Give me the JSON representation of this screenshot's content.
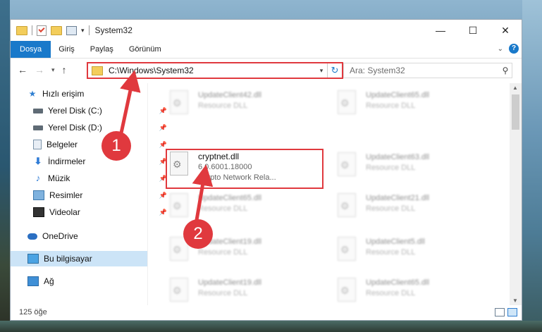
{
  "window": {
    "title": "System32",
    "controls": [
      "minimize-icon",
      "maximize-icon",
      "close-icon"
    ]
  },
  "ribbon": {
    "tabs": [
      {
        "label": "Dosya",
        "active": true
      },
      {
        "label": "Giriş"
      },
      {
        "label": "Paylaş"
      },
      {
        "label": "Görünüm"
      }
    ]
  },
  "address": {
    "path": "C:\\Windows\\System32",
    "search_placeholder": "Ara: System32"
  },
  "sidebar": {
    "quick_access": "Hızlı erişim",
    "items": [
      {
        "label": "Yerel Disk (C:)",
        "icon": "disk-icon",
        "pinned": true
      },
      {
        "label": "Yerel Disk (D:)",
        "icon": "disk-icon",
        "pinned": true
      },
      {
        "label": "Belgeler",
        "icon": "documents-icon",
        "pinned": true
      },
      {
        "label": "İndirmeler",
        "icon": "download-icon",
        "pinned": true
      },
      {
        "label": "Müzik",
        "icon": "music-icon",
        "pinned": true
      },
      {
        "label": "Resimler",
        "icon": "pictures-icon",
        "pinned": true
      },
      {
        "label": "Videolar",
        "icon": "videos-icon",
        "pinned": true
      }
    ],
    "onedrive": "OneDrive",
    "this_pc": "Bu bilgisayar",
    "network": "Ağ"
  },
  "files": {
    "col1": [
      {
        "name": "UpdateClient42.dll",
        "type": "Resource DLL"
      },
      {
        "name": "cryptnet.dll",
        "version": "6.0.6001.18000",
        "type": "Crypto Network Rela..."
      },
      {
        "name": "UpdateClient65.dll",
        "type": "Resource DLL"
      },
      {
        "name": "UpdateClient19.dll",
        "type": "Resource DLL"
      },
      {
        "name": "UpdateClient19.dll",
        "type": "Resource DLL"
      }
    ],
    "col2": [
      {
        "name": "UpdateClient65.dll",
        "type": "Resource DLL"
      },
      {
        "name": "UpdateClient63.dll",
        "type": "Resource DLL"
      },
      {
        "name": "UpdateClient21.dll",
        "type": "Resource DLL"
      },
      {
        "name": "UpdateClient5.dll",
        "type": "Resource DLL"
      },
      {
        "name": "UpdateClient65.dll",
        "type": "Resource DLL"
      }
    ]
  },
  "status": {
    "count": "125 öğe"
  },
  "callouts": [
    "1",
    "2"
  ],
  "colors": {
    "accent": "#1979ca",
    "highlight": "#e0393e"
  }
}
